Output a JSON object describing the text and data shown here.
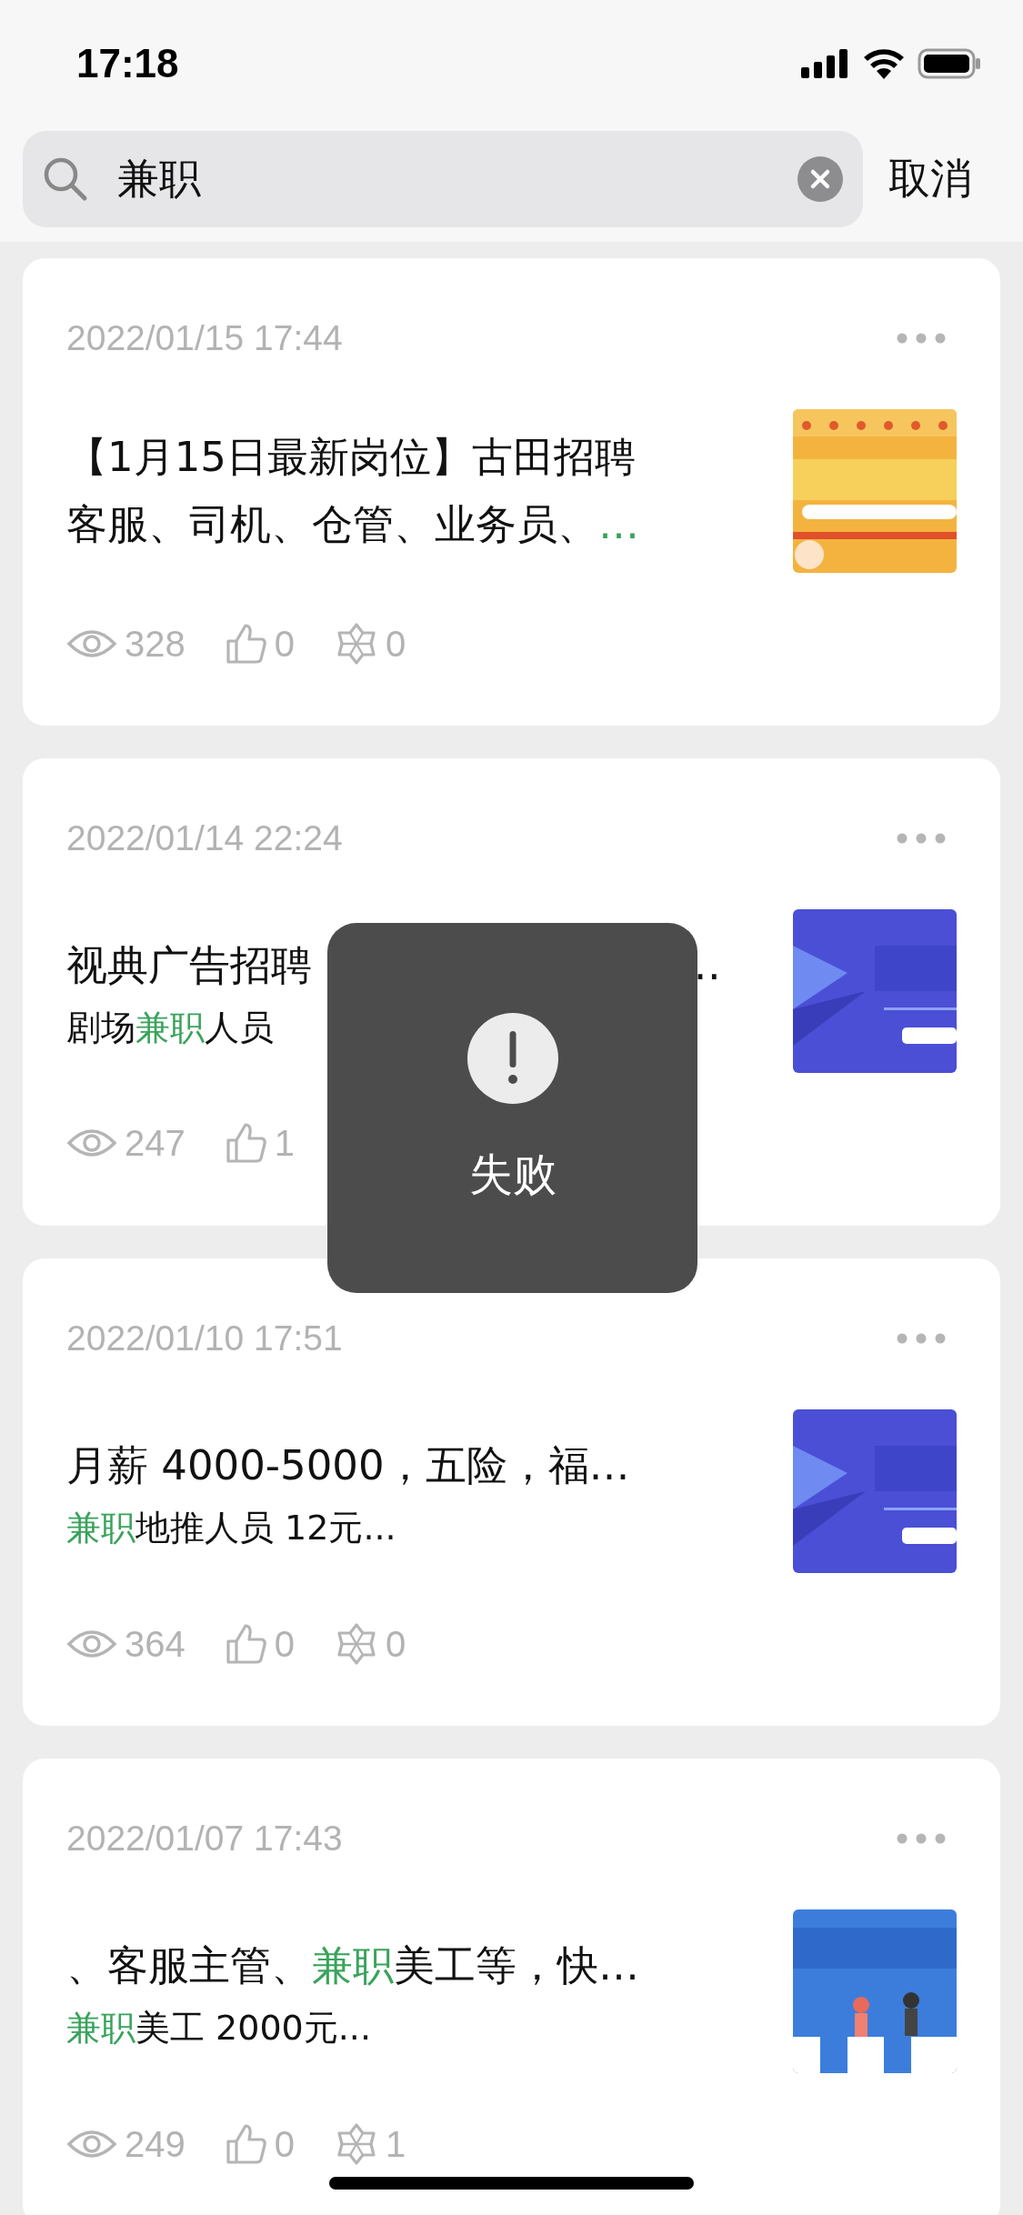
{
  "status_bar": {
    "time": "17:18"
  },
  "search": {
    "value": "兼职",
    "cancel": "取消"
  },
  "posts": [
    {
      "date": "2022/01/15 17:44",
      "title": [
        {
          "text": "【1月15日最新岗位】古田招聘客服、司机、仓管、业务员、",
          "highlight": false
        },
        {
          "text": "…",
          "highlight": true
        }
      ],
      "thumb": {
        "kind": "picture"
      },
      "stats": [
        {
          "kind": "views",
          "value": "328"
        },
        {
          "kind": "likes",
          "value": "0"
        },
        {
          "kind": "shares",
          "value": "0"
        }
      ]
    },
    {
      "date": "2022/01/14 22:24",
      "title": [
        {
          "text": "视典广告招聘",
          "highlight": false
        }
      ],
      "title_end": "…",
      "subtitle": [
        {
          "text": "剧场",
          "highlight": false
        },
        {
          "text": "兼职",
          "highlight": true
        },
        {
          "text": "人员",
          "highlight": false
        }
      ],
      "thumb": {
        "kind": "picture"
      },
      "stats": [
        {
          "kind": "views",
          "value": "247"
        },
        {
          "kind": "likes",
          "value": "1"
        }
      ]
    },
    {
      "date": "2022/01/10 17:51",
      "title": [
        {
          "text": "月薪 4000-5000，五险，福…",
          "highlight": false
        }
      ],
      "subtitle": [
        {
          "text": "兼职",
          "highlight": true
        },
        {
          "text": "地推人员 12元...",
          "highlight": false
        }
      ],
      "thumb": {
        "kind": "picture"
      },
      "stats": [
        {
          "kind": "views",
          "value": "364"
        },
        {
          "kind": "likes",
          "value": "0"
        },
        {
          "kind": "shares",
          "value": "0"
        }
      ]
    },
    {
      "date": "2022/01/07 17:43",
      "title": [
        {
          "text": "、客服主管、",
          "highlight": false
        },
        {
          "text": "兼职",
          "highlight": true
        },
        {
          "text": "美工等，快…",
          "highlight": false
        }
      ],
      "subtitle": [
        {
          "text": "兼职",
          "highlight": true
        },
        {
          "text": "美工 2000元...",
          "highlight": false
        }
      ],
      "thumb": {
        "kind": "picture"
      },
      "stats": [
        {
          "kind": "views",
          "value": "249"
        },
        {
          "kind": "likes",
          "value": "0"
        },
        {
          "kind": "shares",
          "value": "1"
        }
      ]
    }
  ],
  "toast": {
    "message": "失败"
  }
}
